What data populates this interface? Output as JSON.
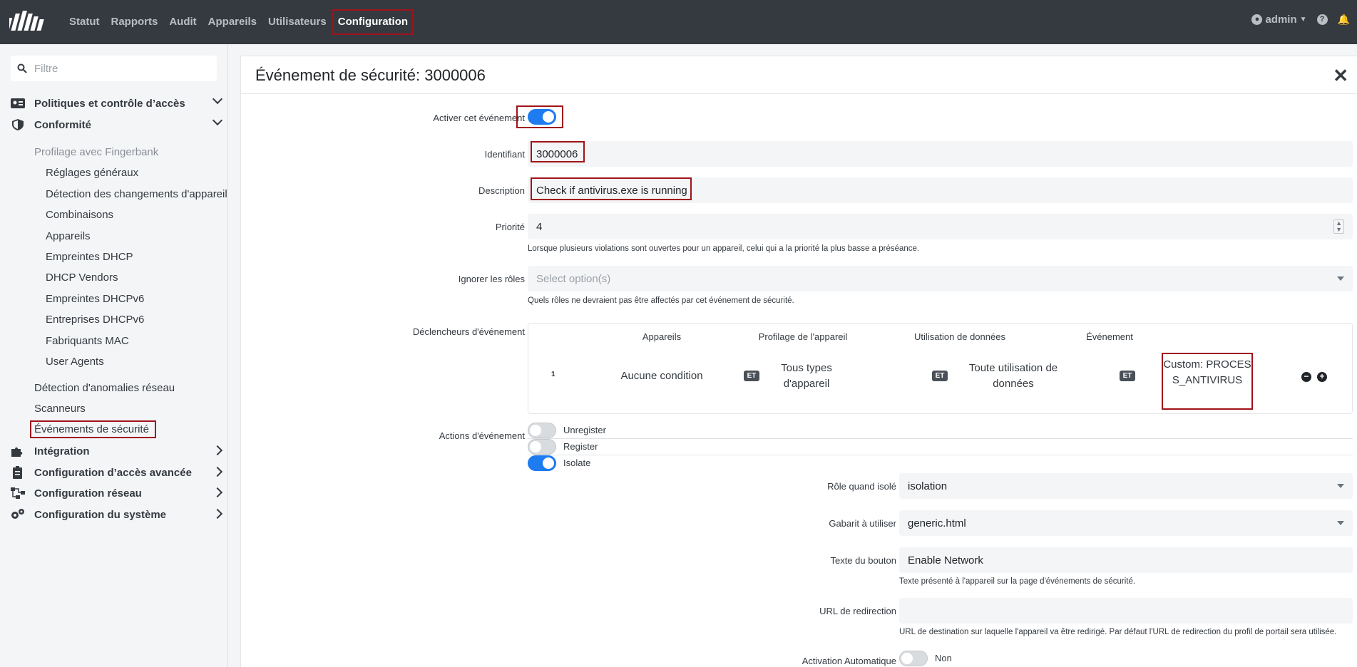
{
  "topbar": {
    "nav": [
      "Statut",
      "Rapports",
      "Audit",
      "Appareils",
      "Utilisateurs",
      "Configuration"
    ],
    "user": "admin",
    "help_icon": "question-circle-icon",
    "bell_icon": "bell-icon"
  },
  "sidebar": {
    "filter_placeholder": "Filtre",
    "sections": {
      "policies": "Politiques et contrôle d’accès",
      "compliance": "Conformité",
      "fingerbank": "Profilage avec Fingerbank",
      "fb_items": [
        "Réglages généraux",
        "Détection des changements d'appareil",
        "Combinaisons",
        "Appareils",
        "Empreintes DHCP",
        "DHCP Vendors",
        "Empreintes DHCPv6",
        "Entreprises DHCPv6",
        "Fabriquants MAC",
        "User Agents"
      ],
      "network_anomaly": "Détection d'anomalies réseau",
      "scanners": "Scanneurs",
      "security_events": "Événements de sécurité",
      "integration": "Intégration",
      "advanced_access": "Configuration d’accès avancée",
      "network_config": "Configuration réseau",
      "system_config": "Configuration du système"
    }
  },
  "form": {
    "title": "Événement de sécurité: 3000006",
    "enable_label": "Activer cet événement",
    "enabled": true,
    "id_label": "Identifiant",
    "id_value": "3000006",
    "desc_label": "Description",
    "desc_value": "Check if antivirus.exe is running",
    "priority_label": "Priorité",
    "priority_value": "4",
    "priority_help": "Lorsque plusieurs violations sont ouvertes pour un appareil, celui qui a la priorité la plus basse a préséance.",
    "ignore_roles_label": "Ignorer les rôles",
    "ignore_roles_placeholder": "Select option(s)",
    "ignore_roles_help": "Quels rôles ne devraient pas être affectés par cet événement de sécurité.",
    "triggers_label": "Déclencheurs d'événement",
    "triggers": {
      "headers": [
        "Appareils",
        "Profilage de l'appareil",
        "Utilisation de données",
        "Événement"
      ],
      "row_number": "1",
      "devices": "Aucune condition",
      "profiling": "Tous types d'appareil",
      "usage": "Toute utilisation de données",
      "event": "Custom: PROCESS_ANTIVIRUS",
      "and_label": "ET"
    },
    "actions_label": "Actions d'événement",
    "actions": [
      {
        "label": "Unregister",
        "on": false
      },
      {
        "label": "Register",
        "on": false
      },
      {
        "label": "Isolate",
        "on": true
      }
    ],
    "isolate_role_label": "Rôle quand isolé",
    "isolate_role_value": "isolation",
    "template_label": "Gabarit à utiliser",
    "template_value": "generic.html",
    "button_text_label": "Texte du bouton",
    "button_text_value": "Enable Network",
    "button_text_help": "Texte présenté à l'appareil sur la page d'événements de sécurité.",
    "redirect_label": "URL de redirection",
    "redirect_value": "",
    "redirect_help": "URL de destination sur laquelle l'appareil va être redirigé. Par défaut l'URL de redirection du profil de portail sera utilisée.",
    "auto_enable_label": "Activation Automatique",
    "auto_enable_value": "Non"
  }
}
